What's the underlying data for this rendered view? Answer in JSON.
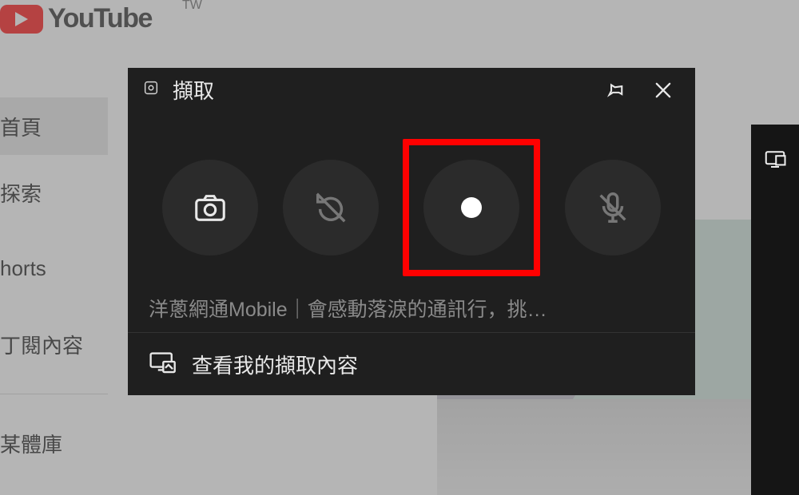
{
  "youtube": {
    "brand": "YouTube",
    "region": "TW",
    "sidebar": [
      "首頁",
      "探索",
      "horts",
      "丁閱內容",
      "某體庫"
    ]
  },
  "gamebar_strip": {
    "icon": "overlay-icon"
  },
  "capture": {
    "title": "擷取",
    "buttons": {
      "screenshot": "screenshot",
      "record_last": "record-last",
      "record": "record",
      "mic": "mic-toggle"
    },
    "source": "洋蔥網通Mobile｜會感動落淚的通訊行，挑…",
    "see_captures": "查看我的擷取內容"
  }
}
